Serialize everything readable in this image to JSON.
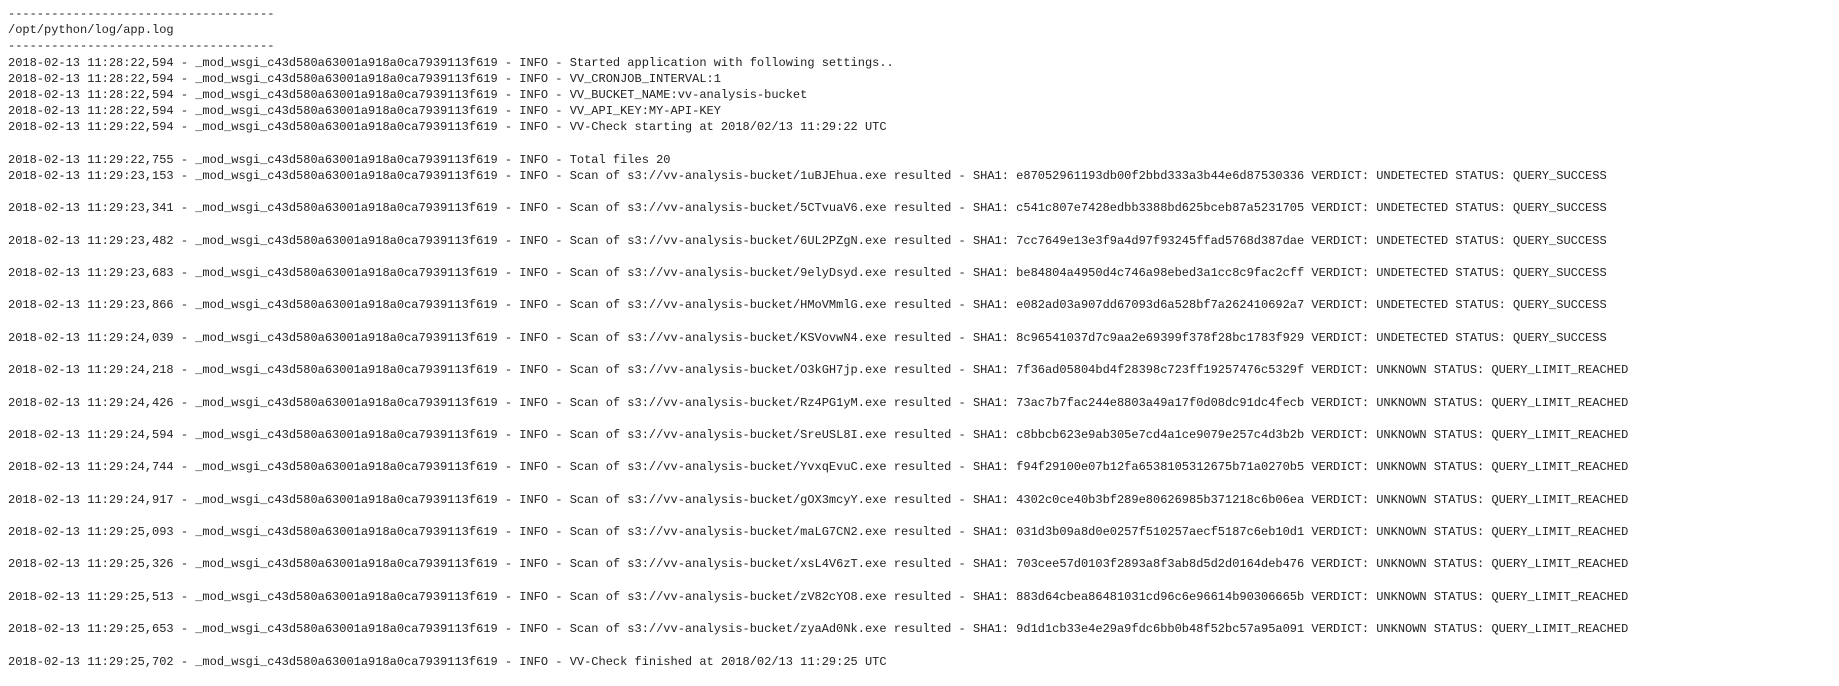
{
  "log": {
    "separator": "-------------------------------------",
    "filepath": "/opt/python/log/app.log",
    "module": "_mod_wsgi_c43d580a63001a918a0ca7939113f619",
    "level": "INFO",
    "scan_prefix": "Scan of s3://vv-analysis-bucket/",
    "scan_mid_resulted": " resulted - SHA1: ",
    "scan_verdict_label": " VERDICT: ",
    "scan_status_label": " STATUS: ",
    "startup": [
      {
        "ts": "2018-02-13 11:28:22,594",
        "msg": "Started application with following settings.."
      },
      {
        "ts": "2018-02-13 11:28:22,594",
        "msg": "VV_CRONJOB_INTERVAL:1"
      },
      {
        "ts": "2018-02-13 11:28:22,594",
        "msg": "VV_BUCKET_NAME:vv-analysis-bucket"
      },
      {
        "ts": "2018-02-13 11:28:22,594",
        "msg": "VV_API_KEY:MY-API-KEY"
      },
      {
        "ts": "2018-02-13 11:29:22,594",
        "msg": "VV-Check starting at 2018/02/13 11:29:22 UTC"
      }
    ],
    "totalfiles": {
      "ts": "2018-02-13 11:29:22,755",
      "msg": "Total files 20"
    },
    "scans": [
      {
        "ts": "2018-02-13 11:29:23,153",
        "file": "1uBJEhua.exe",
        "sha1": "e87052961193db00f2bbd333a3b44e6d87530336",
        "verdict": "UNDETECTED",
        "status": "QUERY_SUCCESS"
      },
      {
        "ts": "2018-02-13 11:29:23,341",
        "file": "5CTvuaV6.exe",
        "sha1": "c541c807e7428edbb3388bd625bceb87a5231705",
        "verdict": "UNDETECTED",
        "status": "QUERY_SUCCESS"
      },
      {
        "ts": "2018-02-13 11:29:23,482",
        "file": "6UL2PZgN.exe",
        "sha1": "7cc7649e13e3f9a4d97f93245ffad5768d387dae",
        "verdict": "UNDETECTED",
        "status": "QUERY_SUCCESS"
      },
      {
        "ts": "2018-02-13 11:29:23,683",
        "file": "9elyDsyd.exe",
        "sha1": "be84804a4950d4c746a98ebed3a1cc8c9fac2cff",
        "verdict": "UNDETECTED",
        "status": "QUERY_SUCCESS"
      },
      {
        "ts": "2018-02-13 11:29:23,866",
        "file": "HMoVMmlG.exe",
        "sha1": "e082ad03a907dd67093d6a528bf7a262410692a7",
        "verdict": "UNDETECTED",
        "status": "QUERY_SUCCESS"
      },
      {
        "ts": "2018-02-13 11:29:24,039",
        "file": "KSVovwN4.exe",
        "sha1": "8c96541037d7c9aa2e69399f378f28bc1783f929",
        "verdict": "UNDETECTED",
        "status": "QUERY_SUCCESS"
      },
      {
        "ts": "2018-02-13 11:29:24,218",
        "file": "O3kGH7jp.exe",
        "sha1": "7f36ad05804bd4f28398c723ff19257476c5329f",
        "verdict": "UNKNOWN",
        "status": "QUERY_LIMIT_REACHED"
      },
      {
        "ts": "2018-02-13 11:29:24,426",
        "file": "Rz4PG1yM.exe",
        "sha1": "73ac7b7fac244e8803a49a17f0d08dc91dc4fecb",
        "verdict": "UNKNOWN",
        "status": "QUERY_LIMIT_REACHED"
      },
      {
        "ts": "2018-02-13 11:29:24,594",
        "file": "SreUSL8I.exe",
        "sha1": "c8bbcb623e9ab305e7cd4a1ce9079e257c4d3b2b",
        "verdict": "UNKNOWN",
        "status": "QUERY_LIMIT_REACHED"
      },
      {
        "ts": "2018-02-13 11:29:24,744",
        "file": "YvxqEvuC.exe",
        "sha1": "f94f29100e07b12fa6538105312675b71a0270b5",
        "verdict": "UNKNOWN",
        "status": "QUERY_LIMIT_REACHED"
      },
      {
        "ts": "2018-02-13 11:29:24,917",
        "file": "gOX3mcyY.exe",
        "sha1": "4302c0ce40b3bf289e80626985b371218c6b06ea",
        "verdict": "UNKNOWN",
        "status": "QUERY_LIMIT_REACHED"
      },
      {
        "ts": "2018-02-13 11:29:25,093",
        "file": "maLG7CN2.exe",
        "sha1": "031d3b09a8d0e0257f510257aecf5187c6eb10d1",
        "verdict": "UNKNOWN",
        "status": "QUERY_LIMIT_REACHED"
      },
      {
        "ts": "2018-02-13 11:29:25,326",
        "file": "xsL4V6zT.exe",
        "sha1": "703cee57d0103f2893a8f3ab8d5d2d0164deb476",
        "verdict": "UNKNOWN",
        "status": "QUERY_LIMIT_REACHED"
      },
      {
        "ts": "2018-02-13 11:29:25,513",
        "file": "zV82cYO8.exe",
        "sha1": "883d64cbea86481031cd96c6e96614b90306665b",
        "verdict": "UNKNOWN",
        "status": "QUERY_LIMIT_REACHED"
      },
      {
        "ts": "2018-02-13 11:29:25,653",
        "file": "zyaAd0Nk.exe",
        "sha1": "9d1d1cb33e4e29a9fdc6bb0b48f52bc57a95a091",
        "verdict": "UNKNOWN",
        "status": "QUERY_LIMIT_REACHED"
      }
    ],
    "finish": {
      "ts": "2018-02-13 11:29:25,702",
      "msg": "VV-Check finished at 2018/02/13 11:29:25 UTC"
    }
  }
}
